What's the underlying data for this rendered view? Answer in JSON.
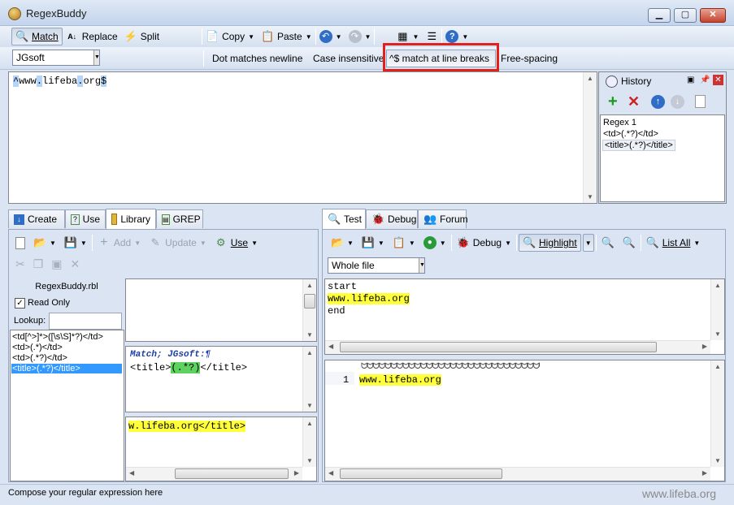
{
  "window": {
    "title": "RegexBuddy",
    "min": "▁",
    "max": "▢",
    "close": "✕"
  },
  "toolbar": {
    "match": "Match",
    "replace": "Replace",
    "split": "Split",
    "copy": "Copy",
    "paste": "Paste"
  },
  "options": {
    "flavor": "JGsoft",
    "dot_newline": "Dot matches newline",
    "case_insensitive": "Case insensitive",
    "line_breaks": "^$ match at line breaks",
    "free_spacing": "Free-spacing"
  },
  "regex": {
    "caret": "^",
    "p1": "www",
    "dot1": ".",
    "p2": "lifeba",
    "dot2": ".",
    "p3": "org",
    "dollar": "$"
  },
  "history": {
    "title": "History",
    "label": "Regex 1",
    "items": [
      "<td>(.*?)</td>",
      "<title>(.*?)</title>"
    ]
  },
  "left_tabs": [
    "Create",
    "Use",
    "Library",
    "GREP"
  ],
  "library": {
    "add": "Add",
    "update": "Update",
    "use": "Use",
    "file": "RegexBuddy.rbl",
    "read_only": "Read Only",
    "lookup": "Lookup:",
    "items": [
      "<td[^>]*>([\\s\\S]*?)</td>",
      "<td>(.*)</td>",
      "<td>(.*?)</td>",
      "<title>(.*?)</title>"
    ],
    "preview_flavor": "Match; JGsoft:¶",
    "preview_a": "<title>",
    "preview_b": "(.*?)",
    "preview_c": "</title>",
    "sample": "w.lifeba.org</title>"
  },
  "right_tabs": [
    "Test",
    "Debug",
    "Forum"
  ],
  "test": {
    "debug": "Debug",
    "highlight": "Highlight",
    "list_all": "List All",
    "scope": "Whole file",
    "lines": [
      "start",
      "www.lifeba.org",
      "end"
    ],
    "ruler": "ᗢᗢᗢᗢᗢᗢᗢᗢᗢᗢᗢᗢᗢᗢᗢᗢᗢᗢᗢᗢᗢᗢᗢᗢᗢᗢᗢᗢᗢᗢᗢᗢᗢᗢᗢᗢᗢᗢᗢᗢᗢᗢᗢᗢᗢ",
    "result_num": "1",
    "result": "www.lifeba.org"
  },
  "status": {
    "text": "Compose your regular expression here",
    "watermark": "www.lifeba.org"
  }
}
